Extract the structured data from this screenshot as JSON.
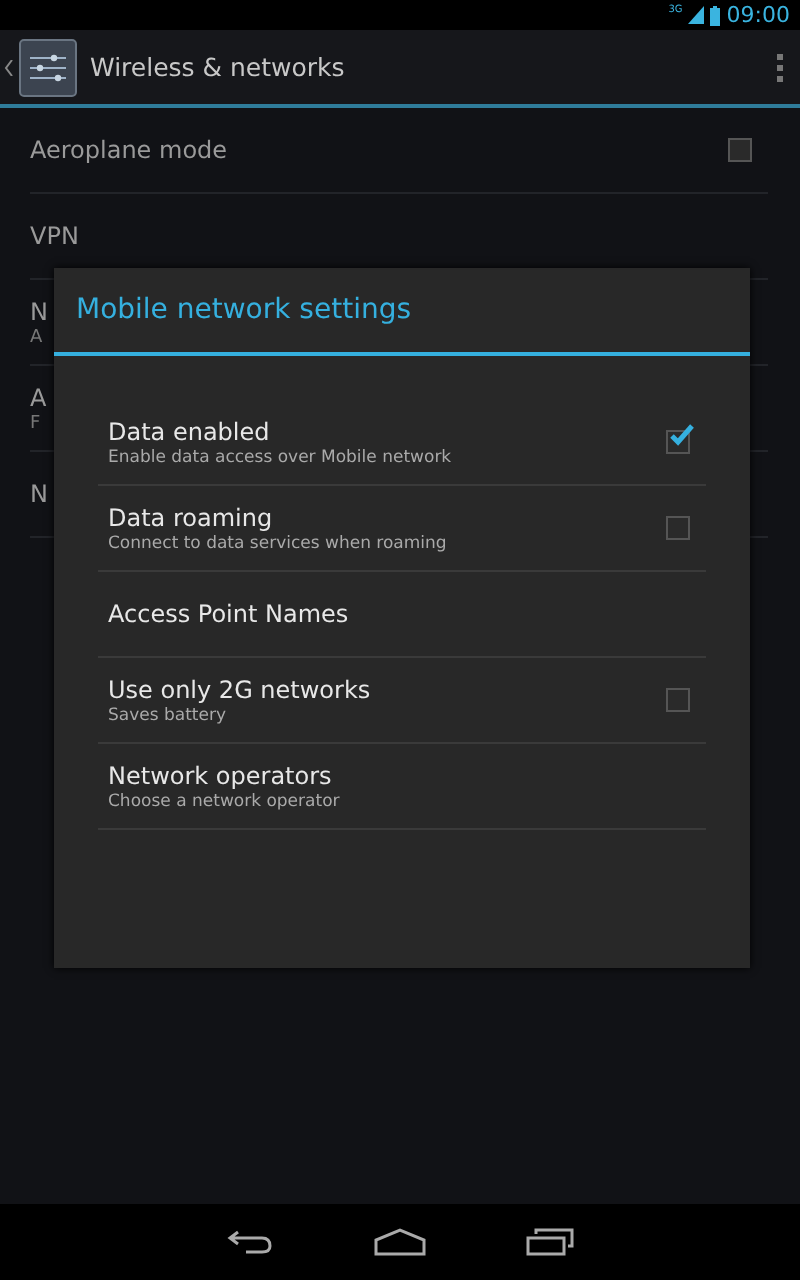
{
  "status_bar": {
    "network": "3G",
    "time": "09:00"
  },
  "action_bar": {
    "title": "Wireless & networks"
  },
  "settings": [
    {
      "title": "Aeroplane mode",
      "kind": "checkbox",
      "checked": false
    },
    {
      "title": "VPN",
      "kind": "plain"
    },
    {
      "title": "N",
      "subtitle": "A",
      "kind": "plain"
    },
    {
      "title": "A",
      "subtitle": "F",
      "kind": "plain"
    },
    {
      "title": "N",
      "kind": "plain"
    }
  ],
  "dialog": {
    "title": "Mobile network settings",
    "items": [
      {
        "title": "Data enabled",
        "subtitle": "Enable data access over Mobile network",
        "kind": "checkbox",
        "checked": true
      },
      {
        "title": "Data roaming",
        "subtitle": "Connect to data services when roaming",
        "kind": "checkbox",
        "checked": false
      },
      {
        "title": "Access Point Names",
        "kind": "plain"
      },
      {
        "title": "Use only 2G networks",
        "subtitle": "Saves battery",
        "kind": "checkbox",
        "checked": false
      },
      {
        "title": "Network operators",
        "subtitle": "Choose a network operator",
        "kind": "plain"
      }
    ]
  }
}
